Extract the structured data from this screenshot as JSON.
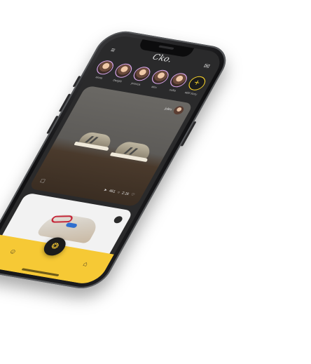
{
  "app": {
    "logo_text": "Cko."
  },
  "header": {
    "menu_icon": "menu-icon",
    "chat_icon": "chat-icon"
  },
  "stories": [
    {
      "name": "anna"
    },
    {
      "name": "dwight"
    },
    {
      "name": "jessica"
    },
    {
      "name": "alex"
    },
    {
      "name": "sofia"
    },
    {
      "name": "add story"
    }
  ],
  "feed": {
    "post1": {
      "poster_name": "jules",
      "share_count": "461",
      "like_count": "2.1k"
    }
  },
  "bottom_nav": {
    "items": [
      "profile-icon",
      "camera-icon",
      "home-icon"
    ]
  },
  "colors": {
    "accent": "#f6c935",
    "story_ring": "#d8a7ef",
    "screen_bg": "#2a2a2b"
  }
}
